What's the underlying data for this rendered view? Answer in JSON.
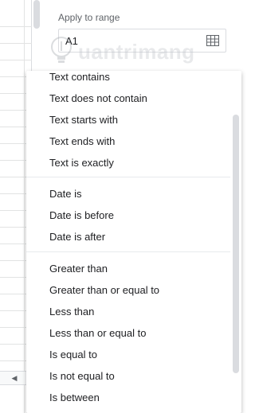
{
  "panel": {
    "range_label": "Apply to range",
    "range_value": "A1",
    "watermark_text": "uantrimang"
  },
  "menu": {
    "group1": [
      "Text contains",
      "Text does not contain",
      "Text starts with",
      "Text ends with",
      "Text is exactly"
    ],
    "group2": [
      "Date is",
      "Date is before",
      "Date is after"
    ],
    "group3": [
      "Greater than",
      "Greater than or equal to",
      "Less than",
      "Less than or equal to",
      "Is equal to",
      "Is not equal to",
      "Is between"
    ]
  },
  "icons": {
    "range_picker": "grid-icon",
    "scroll_left": "chevron-left-icon",
    "watermark_logo": "lightbulb-icon"
  }
}
